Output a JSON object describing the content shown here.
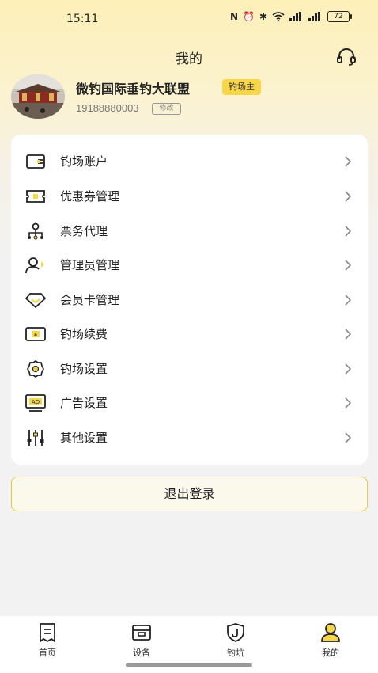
{
  "status_bar": {
    "time": "15:11",
    "battery": "72"
  },
  "header": {
    "title": "我的"
  },
  "profile": {
    "name": "微钓国际垂钓大联盟",
    "role": "钓场主",
    "phone": "19188880003",
    "edit_label": "修改"
  },
  "menu": {
    "items": [
      {
        "label": "钓场账户",
        "icon": "wallet-icon"
      },
      {
        "label": "优惠券管理",
        "icon": "coupon-icon"
      },
      {
        "label": "票务代理",
        "icon": "org-chart-icon"
      },
      {
        "label": "管理员管理",
        "icon": "admin-user-icon"
      },
      {
        "label": "会员卡管理",
        "icon": "diamond-icon"
      },
      {
        "label": "钓场续费",
        "icon": "yen-bill-icon"
      },
      {
        "label": "钓场设置",
        "icon": "settings-icon"
      },
      {
        "label": "广告设置",
        "icon": "ad-icon"
      },
      {
        "label": "其他设置",
        "icon": "sliders-icon"
      }
    ]
  },
  "logout_label": "退出登录",
  "tabbar": {
    "tabs": [
      {
        "label": "首页",
        "icon": "home-doc-icon"
      },
      {
        "label": "设备",
        "icon": "device-icon"
      },
      {
        "label": "钓坑",
        "icon": "fishing-spot-icon"
      },
      {
        "label": "我的",
        "icon": "profile-icon",
        "active": true
      }
    ]
  },
  "colors": {
    "accent": "#f8d64a",
    "logout_border": "#e8c947"
  }
}
